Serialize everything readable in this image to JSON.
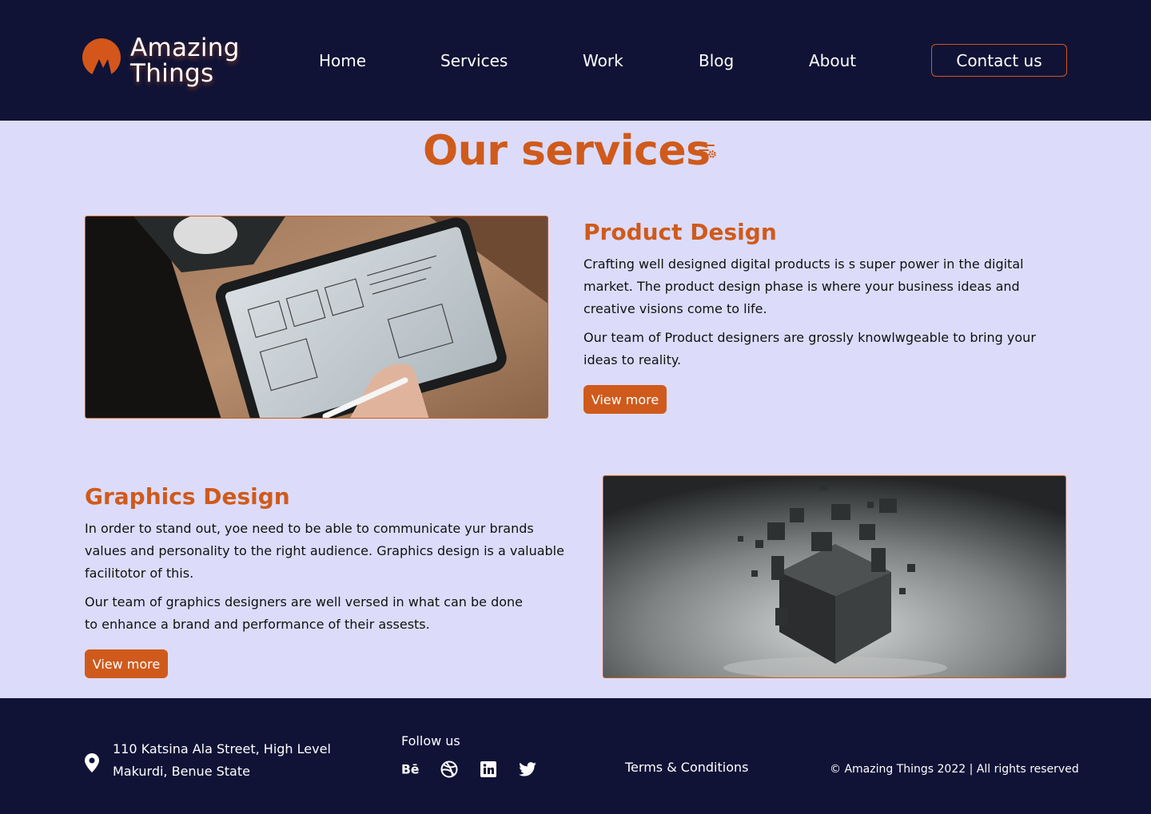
{
  "header": {
    "logo_line1": "Amazing",
    "logo_line2": "Things",
    "nav": [
      "Home",
      "Services",
      "Work",
      "Blog",
      "About"
    ],
    "contact_label": "Contact us"
  },
  "main": {
    "title": "Our services",
    "services": [
      {
        "title": "Product Design",
        "paragraph1": "Crafting well designed digital products is s super power in the digital market. The product design phase is where your business ideas and creative visions come to life.",
        "paragraph2": "Our team of Product designers are grossly knowlwgeable to bring your ideas to reality.",
        "button": "View more"
      },
      {
        "title": "Graphics Design",
        "paragraph1": "In order to stand out, yoe need to be able to communicate yur brands values and personality to the right audience. Graphics design is a valuable facilitotor of this.",
        "paragraph2": "Our team of graphics designers are well versed in what can be done to enhance a brand and performance of their assests.",
        "button": "View more"
      }
    ]
  },
  "footer": {
    "address_line1": "110 Katsina Ala Street, High Level",
    "address_line2": "Makurdi, Benue State",
    "follow_label": "Follow us",
    "socials": [
      "behance-icon",
      "dribbble-icon",
      "linkedin-icon",
      "twitter-icon"
    ],
    "terms": "Terms & Conditions",
    "copyright": "© Amazing Things 2022 | All rights reserved"
  },
  "colors": {
    "header_bg": "#101336",
    "page_bg": "#dcdcfa",
    "accent": "#cf5a1c",
    "text": "#111111"
  }
}
